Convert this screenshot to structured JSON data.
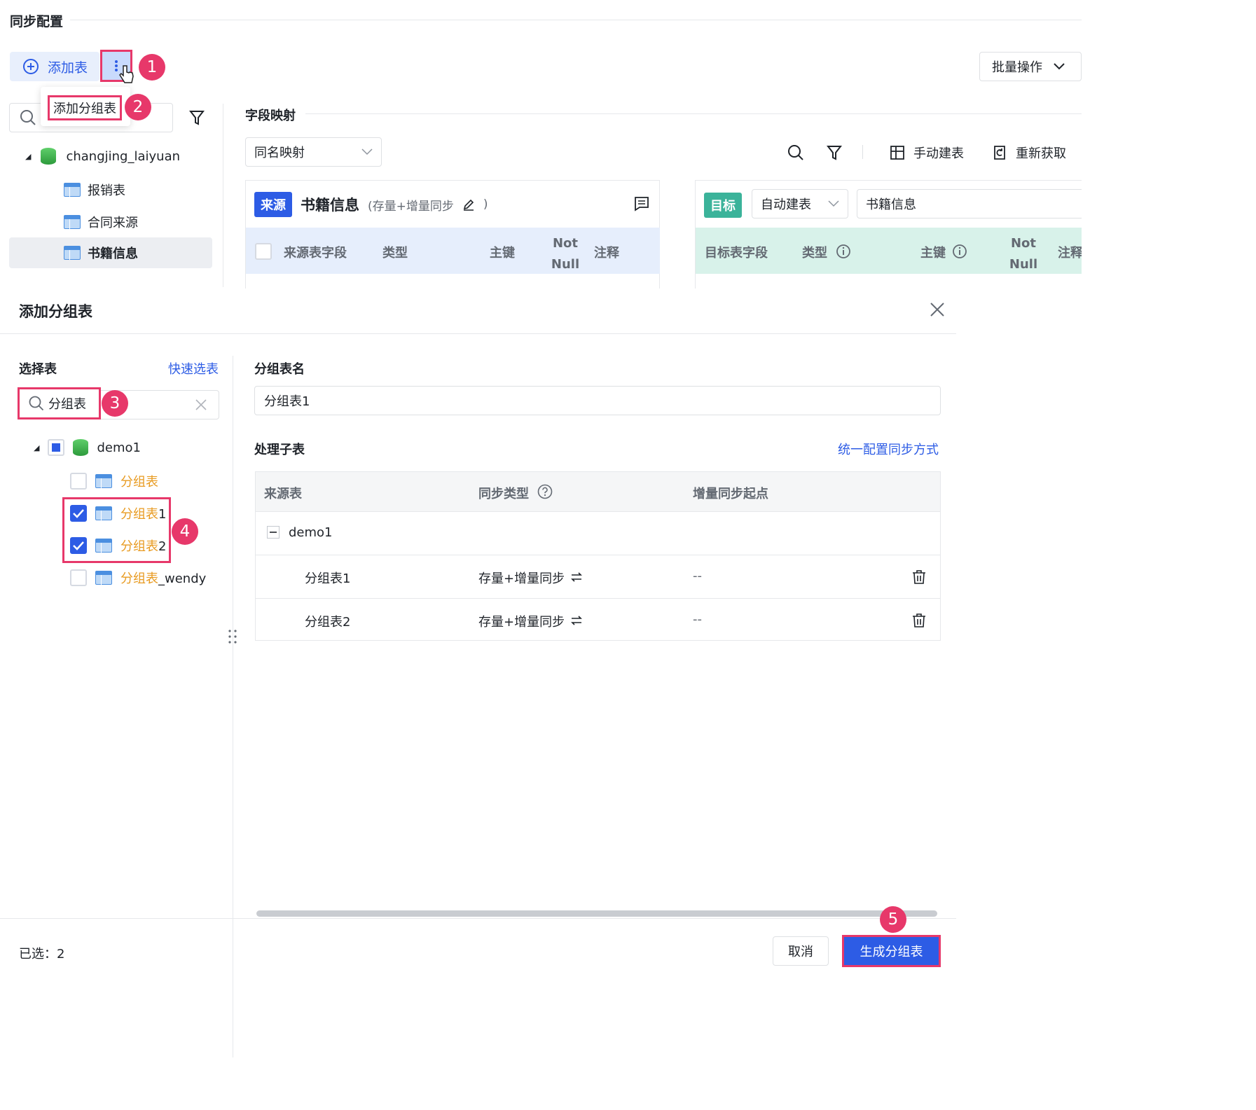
{
  "top": {
    "title": "同步配置",
    "add_table": "添加表",
    "batch_ops": "批量操作",
    "menu_item": "添加分组表",
    "search_placeholder": "",
    "tree": {
      "db": "changjing_laiyuan",
      "tables": [
        "报销表",
        "合同来源",
        "书籍信息"
      ],
      "selected": "书籍信息"
    },
    "field_mapping": {
      "title": "字段映射",
      "mapping_mode": "同名映射",
      "manual_create": "手动建表",
      "refresh": "重新获取",
      "source_tag": "来源",
      "source_table": "书籍信息",
      "source_mode": "(存量+增量同步",
      "source_mode_end": ")",
      "source_cols": [
        "来源表字段",
        "类型",
        "主键",
        "Not Null",
        "注释"
      ],
      "target_tag": "目标",
      "target_mode": "自动建表",
      "target_table": "书籍信息",
      "target_cols": [
        "目标表字段",
        "类型",
        "主键",
        "Not Null",
        "注释"
      ]
    }
  },
  "dialog": {
    "title": "添加分组表",
    "select_table": "选择表",
    "quick_select": "快速选表",
    "search_value": "分组表",
    "tree": {
      "db": "demo1",
      "items": [
        {
          "prefix": "分组表",
          "suffix": "",
          "checked": false
        },
        {
          "prefix": "分组表",
          "suffix": "1",
          "checked": true
        },
        {
          "prefix": "分组表",
          "suffix": "2",
          "checked": true
        },
        {
          "prefix": "分组表",
          "suffix": "_wendy",
          "checked": false
        }
      ]
    },
    "group_name_label": "分组表名",
    "group_name_value": "分组表1",
    "sub_tables_label": "处理子表",
    "unify_link": "统一配置同步方式",
    "columns": [
      "来源表",
      "同步类型",
      "增量同步起点"
    ],
    "group_row": "demo1",
    "rows": [
      {
        "name": "分组表1",
        "type": "存量+增量同步",
        "start": "--"
      },
      {
        "name": "分组表2",
        "type": "存量+增量同步",
        "start": "--"
      }
    ],
    "selected_count": "已选：2",
    "cancel": "取消",
    "generate": "生成分组表"
  },
  "steps": [
    "1",
    "2",
    "3",
    "4",
    "5"
  ],
  "colors": {
    "accent": "#2d5ce5",
    "highlight": "#e7386a",
    "orange": "#e89b22",
    "teal": "#3bb39a"
  }
}
